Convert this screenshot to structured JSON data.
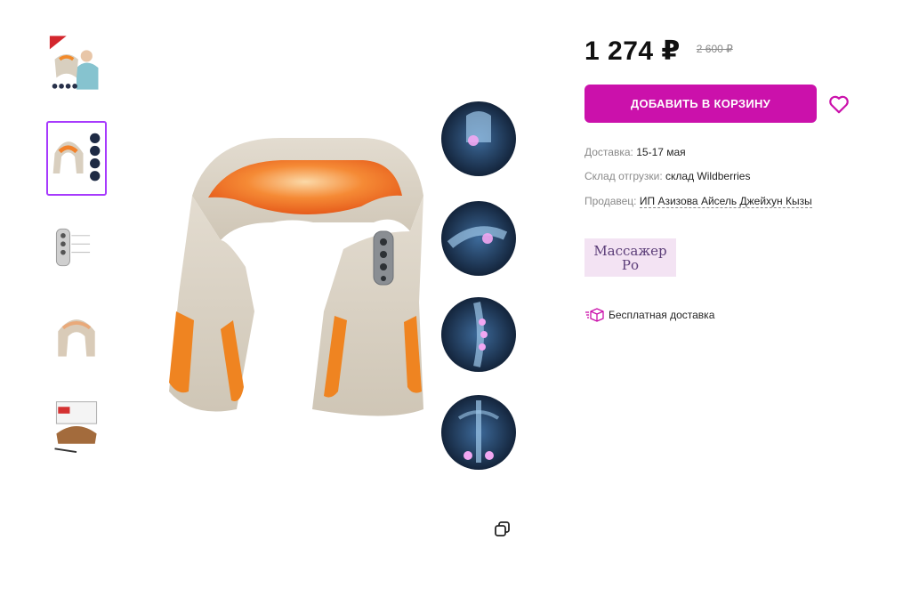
{
  "product": {
    "price": "1 274 ₽",
    "old_price": "2 600 ₽",
    "add_to_cart_label": "ДОБАВИТЬ В КОРЗИНУ",
    "delivery_label": "Доставка:",
    "delivery_value": "15-17 мая",
    "warehouse_label": "Склад отгрузки:",
    "warehouse_value": "склад Wildberries",
    "seller_label": "Продавец:",
    "seller_value": "ИП Азизова Айсель Джейхун Кызы",
    "brand_line1": "Массажер",
    "brand_line2": "Ро",
    "free_delivery_label": "Бесплатная доставка"
  },
  "gallery": {
    "thumbnails": [
      "massager-on-woman",
      "massager-with-body-parts",
      "massager-control-panel",
      "massager-front",
      "massager-in-box"
    ],
    "active_index": 1
  },
  "icons": {
    "favorite": "heart-icon",
    "zoom": "expand-icon",
    "free_delivery": "box-icon"
  },
  "colors": {
    "accent": "#cb11ab",
    "active_border": "#a73afd",
    "muted_text": "#8a8a8a"
  }
}
